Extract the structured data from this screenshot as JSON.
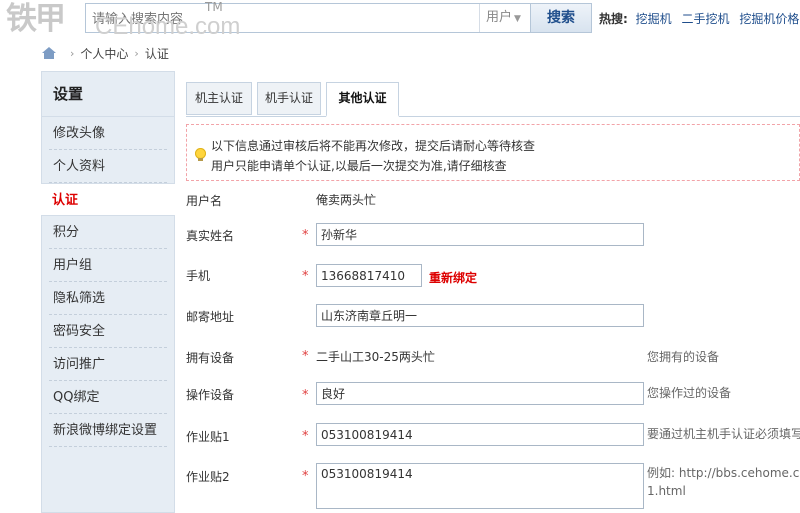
{
  "header": {
    "logo_cn": "铁甲",
    "logo_en": "CEhome.com",
    "logo_tm": "TM",
    "search_placeholder": "请输入搜索内容",
    "search_scope": "用户",
    "search_button": "搜索",
    "hot_label": "热搜:",
    "hot_links": [
      "挖掘机",
      "二手挖机",
      "挖掘机价格"
    ]
  },
  "breadcrumb": {
    "items": [
      "个人中心",
      "认证"
    ]
  },
  "sidebar": {
    "title": "设置",
    "items": [
      "修改头像",
      "个人资料",
      "认证",
      "积分",
      "用户组",
      "隐私筛选",
      "密码安全",
      "访问推广",
      "QQ绑定",
      "新浪微博绑定设置"
    ],
    "active_index": 2
  },
  "tabs": [
    "机主认证",
    "机手认证",
    "其他认证"
  ],
  "active_tab": "其他认证",
  "notice": {
    "line1": "以下信息通过审核后将不能再次修改，提交后请耐心等待核查",
    "line2": "用户只能申请单个认证,以最后一次提交为准,请仔细核查"
  },
  "form": {
    "username_label": "用户名",
    "username_value": "俺卖两头忙",
    "realname_label": "真实姓名",
    "realname_value": "孙新华",
    "phone_label": "手机",
    "phone_value": "13668817410",
    "rebind_label": "重新绑定",
    "address_label": "邮寄地址",
    "address_value": "山东济南章丘明一",
    "equipment_label": "拥有设备",
    "equipment_value": "二手山工30-25两头忙",
    "equipment_hint": "您拥有的设备",
    "operate_label": "操作设备",
    "operate_value": "良好",
    "operate_hint": "您操作过的设备",
    "post1_label": "作业贴1",
    "post1_value": "053100819414",
    "post1_hint": "要通过机主机手认证必须填写",
    "post2_label": "作业贴2",
    "post2_value": "053100819414",
    "post2_hint_line1": "例如: http://bbs.cehome.c",
    "post2_hint_line2": "1.html",
    "required_mark": "*"
  },
  "colors": {
    "accent_blue": "#1f4e8c",
    "active_red": "#dd0000",
    "sidebar_bg": "#e6edf4"
  }
}
